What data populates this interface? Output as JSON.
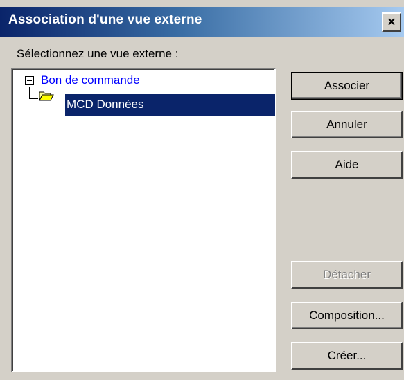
{
  "window": {
    "title": "Association d'une vue externe",
    "close_glyph": "×"
  },
  "prompt": "Sélectionnez une vue externe :",
  "tree": {
    "root": {
      "label": "Bon de commande",
      "expanded": true,
      "icon": "minus-box-icon"
    },
    "children": [
      {
        "label": "MCD Données",
        "selected": true,
        "icon": "folder-open-icon"
      }
    ]
  },
  "buttons": {
    "associer": "Associer",
    "annuler": "Annuler",
    "aide": "Aide",
    "detacher": "Détacher",
    "composition": "Composition...",
    "creer": "Créer..."
  },
  "colors": {
    "title_gradient_start": "#0a246a",
    "title_gradient_end": "#a6caf0",
    "selection": "#0a246a",
    "root_label": "#0000ff",
    "dialog_bg": "#d4d0c8"
  }
}
